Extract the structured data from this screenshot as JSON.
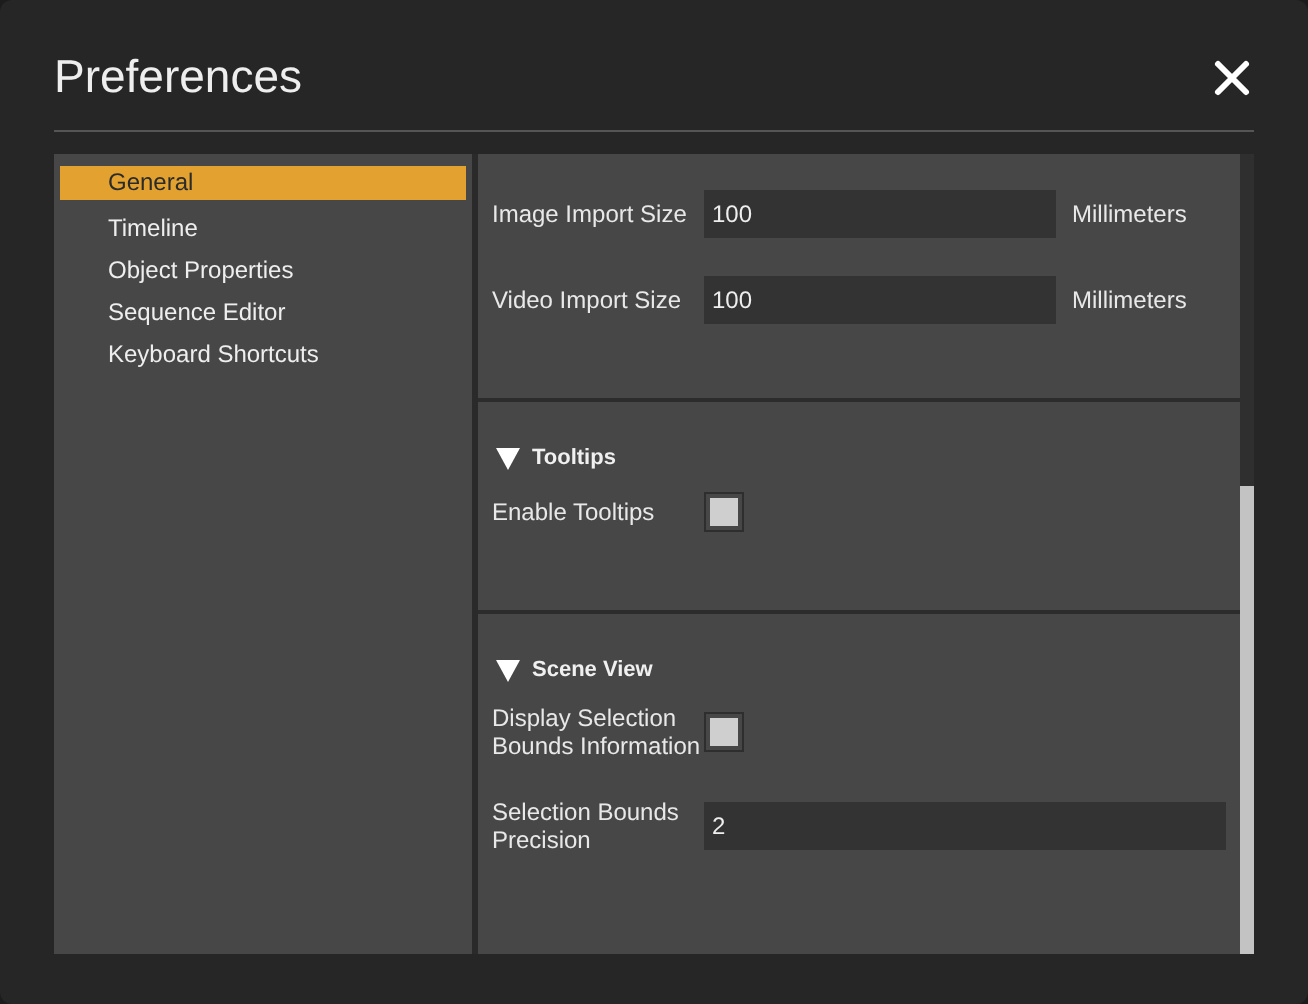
{
  "window": {
    "title": "Preferences"
  },
  "sidebar": {
    "items": [
      {
        "label": "General",
        "selected": true
      },
      {
        "label": "Timeline",
        "selected": false
      },
      {
        "label": "Object Properties",
        "selected": false
      },
      {
        "label": "Sequence Editor",
        "selected": false
      },
      {
        "label": "Keyboard Shortcuts",
        "selected": false
      }
    ]
  },
  "sections": [
    {
      "rows": [
        {
          "kind": "input",
          "label": "Image Import Size",
          "value": "100",
          "unit": "Millimeters"
        },
        {
          "kind": "input",
          "label": "Video Import Size",
          "value": "100",
          "unit": "Millimeters"
        }
      ]
    },
    {
      "title": "Tooltips",
      "expanded": true,
      "rows": [
        {
          "kind": "checkbox",
          "label": "Enable Tooltips",
          "checked": false
        }
      ]
    },
    {
      "title": "Scene View",
      "expanded": true,
      "rows": [
        {
          "kind": "checkbox",
          "label": "Display Selection Bounds Information",
          "checked": false
        },
        {
          "kind": "input",
          "label": "Selection Bounds Precision",
          "value": "2"
        }
      ]
    }
  ]
}
